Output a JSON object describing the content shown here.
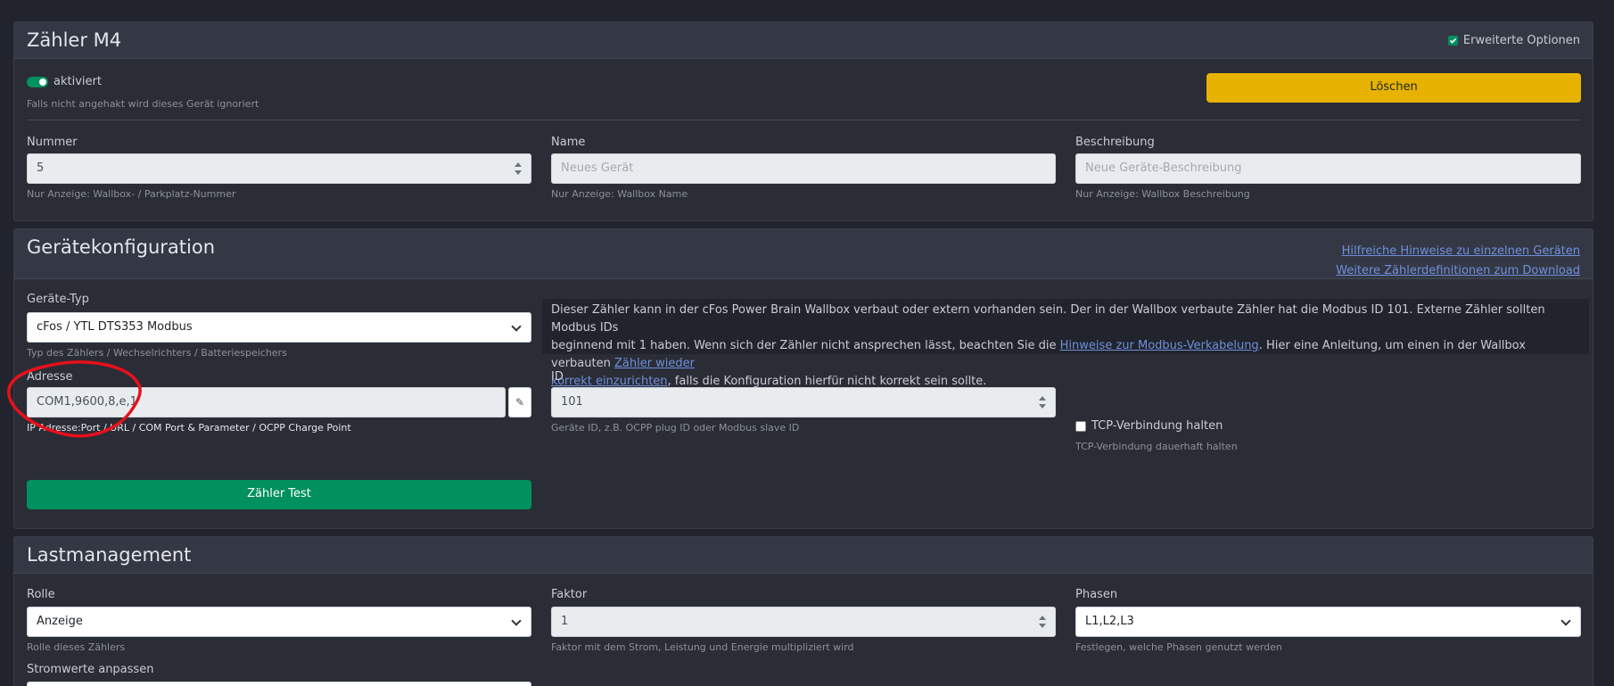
{
  "meter": {
    "title": "Zähler M4",
    "advanced_label": "Erweiterte Optionen",
    "advanced_checked": true,
    "activated_label": "aktiviert",
    "activated_on": true,
    "activated_hint": "Falls nicht angehakt wird dieses Gerät ignoriert",
    "delete_label": "Löschen",
    "number_label": "Nummer",
    "number_value": "5",
    "number_hint": "Nur Anzeige: Wallbox- / Parkplatz-Nummer",
    "name_label": "Name",
    "name_placeholder": "Neues Gerät",
    "name_hint": "Nur Anzeige: Wallbox Name",
    "desc_label": "Beschreibung",
    "desc_placeholder": "Neue Geräte-Beschreibung",
    "desc_hint": "Nur Anzeige: Wallbox Beschreibung"
  },
  "config": {
    "title": "Gerätekonfiguration",
    "link_hints": "Hilfreiche Hinweise zu einzelnen Geräten",
    "link_download": "Weitere Zählerdefinitionen zum Download",
    "type_label": "Geräte-Typ",
    "type_value": "cFos / YTL DTS353 Modbus",
    "type_hint": "Typ des Zählers / Wechselrichters / Batteriespeichers",
    "info_text_1": "Dieser Zähler kann in der cFos Power Brain Wallbox verbaut oder extern vorhanden sein. Der in der Wallbox verbaute Zähler hat die Modbus ID 101. Externe Zähler sollten Modbus IDs",
    "info_text_2": "beginnend mit 1 haben. Wenn sich der Zähler nicht ansprechen lässt, beachten Sie die ",
    "info_link_1": "Hinweise zur Modbus-Verkabelung",
    "info_text_3": ". Hier eine Anleitung, um einen in der Wallbox verbauten ",
    "info_link_2a": "Zähler wieder",
    "info_link_2b": "korrekt einzurichten",
    "info_text_4": ", falls die Konfiguration hierfür nicht korrekt sein sollte.",
    "address_label": "Adresse",
    "address_value": "COM1,9600,8,e,1",
    "address_hint": "IP Adresse:Port / URL / COM Port & Parameter / OCPP Charge Point",
    "edit_icon": "pencil-icon",
    "id_label": "ID",
    "id_value": "101",
    "id_hint": "Geräte ID, z.B. OCPP plug ID oder Modbus slave ID",
    "tcp_label": "TCP-Verbindung halten",
    "tcp_checked": false,
    "tcp_hint": "TCP-Verbindung dauerhaft halten",
    "test_label": "Zähler Test"
  },
  "load": {
    "title": "Lastmanagement",
    "role_label": "Rolle",
    "role_value": "Anzeige",
    "role_hint": "Rolle dieses Zählers",
    "factor_label": "Faktor",
    "factor_value": "1",
    "factor_hint": "Faktor mit dem Strom, Leistung und Energie multipliziert wird",
    "phases_label": "Phasen",
    "phases_value": "L1,L2,L3",
    "phases_hint": "Festlegen, welche Phasen genutzt werden",
    "current_label": "Stromwerte anpassen"
  },
  "colors": {
    "accent_yellow": "#e7b300",
    "accent_green": "#00915e",
    "annotation_red": "#e8101a",
    "link": "#6f8fdc"
  }
}
